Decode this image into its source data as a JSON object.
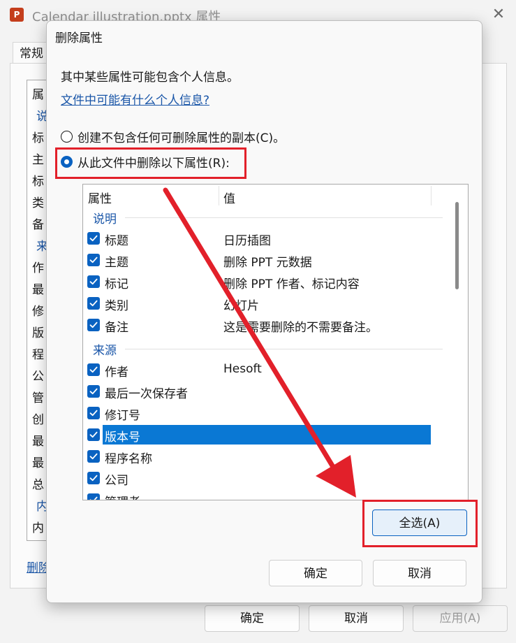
{
  "background_window": {
    "title": "Calendar illustration.pptx 属性",
    "app_icon_letter": "P",
    "close_glyph": "✕",
    "tab": "常规",
    "list_rows": [
      {
        "text": "属",
        "section": false
      },
      {
        "text": "说",
        "section": true
      },
      {
        "text": "标",
        "section": false
      },
      {
        "text": "主",
        "section": false
      },
      {
        "text": "标",
        "section": false
      },
      {
        "text": "类",
        "section": false
      },
      {
        "text": "备",
        "section": false
      },
      {
        "text": "来",
        "section": true
      },
      {
        "text": "作",
        "section": false
      },
      {
        "text": "最",
        "section": false
      },
      {
        "text": "修",
        "section": false
      },
      {
        "text": "版",
        "section": false
      },
      {
        "text": "程",
        "section": false
      },
      {
        "text": "公",
        "section": false
      },
      {
        "text": "管",
        "section": false
      },
      {
        "text": "创",
        "section": false
      },
      {
        "text": "最",
        "section": false
      },
      {
        "text": "最",
        "section": false
      },
      {
        "text": "总",
        "section": false
      },
      {
        "text": "内",
        "section": true
      },
      {
        "text": "内",
        "section": false
      }
    ],
    "remove_link": "删除",
    "buttons": {
      "ok": "确定",
      "cancel": "取消",
      "apply": "应用(A)"
    }
  },
  "dialog": {
    "title": "删除属性",
    "intro": "其中某些属性可能包含个人信息。",
    "link": "文件中可能有什么个人信息?",
    "option_copy": "创建不包含任何可删除属性的副本(C)。",
    "option_remove": "从此文件中删除以下属性(R):",
    "selected_option": "remove",
    "columns": {
      "name": "属性",
      "value": "值"
    },
    "sections": [
      {
        "label": "说明",
        "rows": [
          {
            "name": "标题",
            "value": "日历插图",
            "checked": true,
            "selected": false
          },
          {
            "name": "主题",
            "value": "删除 PPT 元数据",
            "checked": true,
            "selected": false
          },
          {
            "name": "标记",
            "value": "删除 PPT 作者、标记内容",
            "checked": true,
            "selected": false
          },
          {
            "name": "类别",
            "value": "幻灯片",
            "checked": true,
            "selected": false
          },
          {
            "name": "备注",
            "value": "这是需要删除的不需要备注。",
            "checked": true,
            "selected": false
          }
        ]
      },
      {
        "label": "来源",
        "rows": [
          {
            "name": "作者",
            "value": "Hesoft",
            "checked": true,
            "selected": false
          },
          {
            "name": "最后一次保存者",
            "value": "",
            "checked": true,
            "selected": false
          },
          {
            "name": "修订号",
            "value": "",
            "checked": true,
            "selected": false
          },
          {
            "name": "版本号",
            "value": "",
            "checked": true,
            "selected": true
          },
          {
            "name": "程序名称",
            "value": "",
            "checked": true,
            "selected": false
          },
          {
            "name": "公司",
            "value": "",
            "checked": true,
            "selected": false
          },
          {
            "name": "管理者",
            "value": "",
            "checked": true,
            "selected": false
          }
        ]
      }
    ],
    "select_all": "全选(A)",
    "ok": "确定",
    "cancel": "取消",
    "highlight_color": "#e2202a",
    "accent_color": "#0a62c1"
  }
}
